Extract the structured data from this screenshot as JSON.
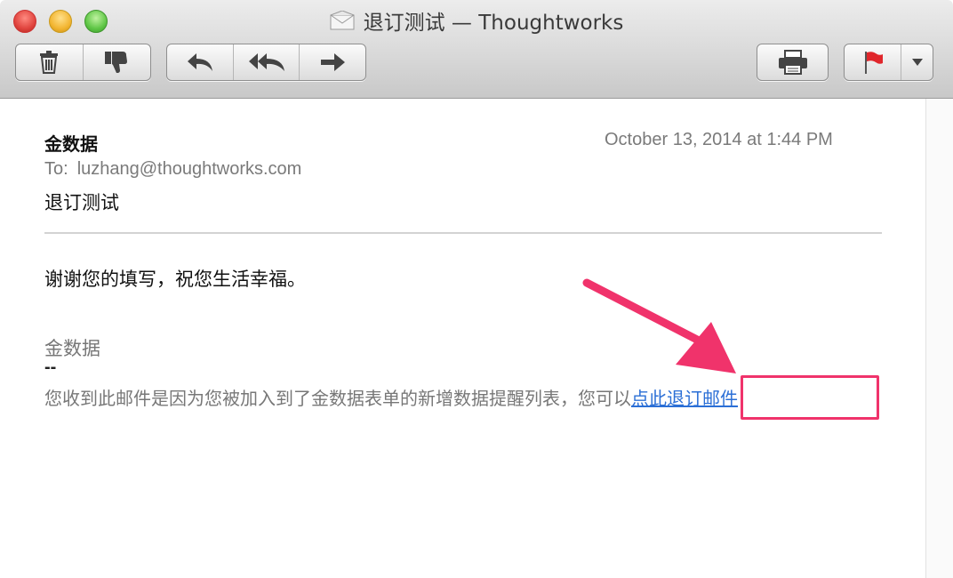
{
  "window": {
    "title": "退订测试 — Thoughtworks",
    "title_icon": "envelope-icon"
  },
  "toolbar": {
    "delete_icon": "trash-icon",
    "junk_icon": "thumbs-down-icon",
    "reply_icon": "reply-icon",
    "reply_all_icon": "reply-all-icon",
    "forward_icon": "forward-icon",
    "print_icon": "printer-icon",
    "flag_icon": "flag-icon",
    "flag_menu_icon": "chevron-down-icon"
  },
  "message": {
    "from": "金数据",
    "date": "October 13, 2014 at 1:44 PM",
    "to_label": "To:",
    "to_address": "luzhang@thoughtworks.com",
    "subject": "退订测试",
    "body": "谢谢您的填写，祝您生活幸福。",
    "signature_name": "金数据",
    "signature_separator": "--",
    "footer_text": "您收到此邮件是因为您被加入到了金数据表单的新增数据提醒列表，您可以",
    "unsubscribe_link": "点此退订邮件"
  },
  "annotation": {
    "color": "#f0336b"
  }
}
